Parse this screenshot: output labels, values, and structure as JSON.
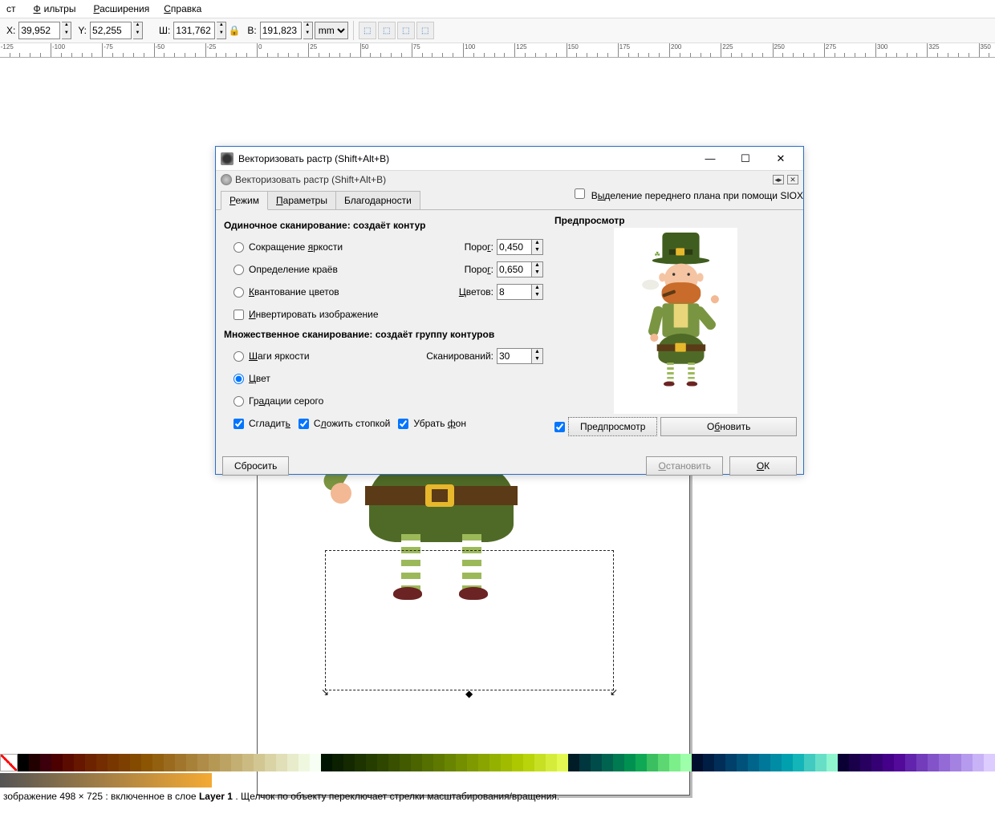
{
  "menu": {
    "items": [
      "ст",
      "Фильтры",
      "Расширения",
      "Справка"
    ]
  },
  "toolbar": {
    "x_label": "X:",
    "x_value": "39,952",
    "y_label": "Y:",
    "y_value": "52,255",
    "w_label": "Ш:",
    "w_value": "131,762",
    "h_label": "В:",
    "h_value": "191,823",
    "units": "mm"
  },
  "ruler": {
    "start": -225,
    "end": 1300,
    "step": 25
  },
  "dialog": {
    "title": "Векторизовать растр (Shift+Alt+B)",
    "subtitle": "Векторизовать растр (Shift+Alt+B)",
    "tabs": [
      "Режим",
      "Параметры",
      "Благодарности"
    ],
    "siox_label": "Выделение переднего плана при помощи SIOX",
    "single_title": "Одиночное сканирование: создаёт контур",
    "brightness": "Сокращение яркости",
    "threshold1_label": "Порог:",
    "threshold1_value": "0,450",
    "edges": "Определение краёв",
    "threshold2_label": "Порог:",
    "threshold2_value": "0,650",
    "colorquant": "Квантование цветов",
    "colors_label": "Цветов:",
    "colors_value": "8",
    "invert": "Инвертировать изображение",
    "multi_title": "Множественное сканирование: создаёт группу контуров",
    "bright_steps": "Шаги яркости",
    "scans_label": "Сканирований:",
    "scans_value": "30",
    "color": "Цвет",
    "gray": "Градации серого",
    "smooth": "Сгладить",
    "stack": "Сложить стопкой",
    "remove_bg": "Убрать фон",
    "preview_title": "Предпросмотр",
    "preview_chk": "Предпросмотр",
    "update_btn": "Обновить",
    "reset_btn": "Сбросить",
    "stop_btn": "Остановить",
    "ok_btn": "OK"
  },
  "statusbar": {
    "prefix": "зображение ",
    "dims": "498 × 725",
    "mid": ": включенное в слое ",
    "layer": "Layer 1",
    "suffix": ". Щелчок по объекту переключает стрелки масштабирования/вращения."
  },
  "palette_colors": [
    "#000",
    "#230000",
    "#3b000b",
    "#4c0000",
    "#5c0b00",
    "#671700",
    "#6d2300",
    "#732d00",
    "#793700",
    "#7e4000",
    "#844a00",
    "#8c5504",
    "#936010",
    "#9a6b1e",
    "#a1762c",
    "#a88139",
    "#af8c47",
    "#b69855",
    "#bda363",
    "#c4af72",
    "#cbbb82",
    "#d2c793",
    "#d9d3a5",
    "#e0dfb7",
    "#e8eccb",
    "#eff8df",
    "#f7fff4",
    "#011600",
    "#0b2000",
    "#142900",
    "#1d3300",
    "#263d00",
    "#2f4600",
    "#385000",
    "#425a00",
    "#4b6400",
    "#556f00",
    "#5f7900",
    "#698400",
    "#748f00",
    "#7f9a00",
    "#8aa500",
    "#95b100",
    "#a1bc00",
    "#adc800",
    "#bad40c",
    "#c7e023",
    "#d5ed3a",
    "#e3f952",
    "#001c27",
    "#00363d",
    "#004c4a",
    "#00634f",
    "#007a51",
    "#009151",
    "#0fa955",
    "#3ac060",
    "#5cd772",
    "#7cef8b",
    "#9effaa",
    "#000f2e",
    "#001e44",
    "#002e58",
    "#00406a",
    "#00527b",
    "#00658b",
    "#007899",
    "#008ca5",
    "#00a0af",
    "#14b5b8",
    "#41cac0",
    "#67dfc7",
    "#8ef5cf",
    "#0b0033",
    "#1a004a",
    "#280060",
    "#360075",
    "#440089",
    "#530a9b",
    "#6224ac",
    "#723cbb",
    "#8253c9",
    "#936ad6",
    "#a482e2",
    "#b69aed",
    "#c9b3f7",
    "#ddccff"
  ]
}
